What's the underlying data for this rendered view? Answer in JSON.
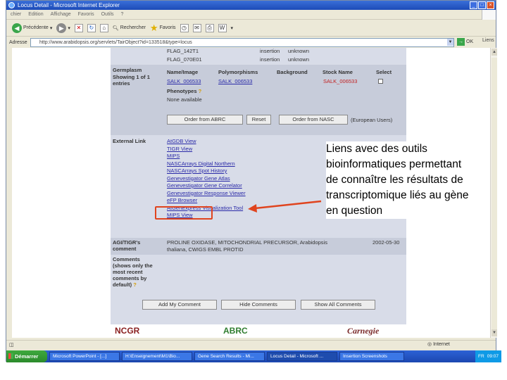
{
  "window": {
    "title": "Locus Detail - Microsoft Internet Explorer",
    "buttons": [
      "_",
      "□",
      "×"
    ]
  },
  "menubar": [
    "chier",
    "Edition",
    "Affichage",
    "Favoris",
    "Outils",
    "?"
  ],
  "toolbar": {
    "back_label": "Précédente",
    "search_label": "Rechercher",
    "favorites_label": "Favoris"
  },
  "address": {
    "label": "Adresse",
    "url": "http://www.arabidopsis.org/servlets/TairObject?id=133518&type=locus",
    "go_label": "OK",
    "links_label": "Liens"
  },
  "page": {
    "top_rows": [
      {
        "name": "FLAG_142T1",
        "type": "insertion",
        "status": "unknown"
      },
      {
        "name": "FLAG_070E01",
        "type": "insertion",
        "status": "unknown"
      }
    ],
    "germplasm": {
      "label": "Germplasm",
      "showing": "Showing 1 of 1 entries",
      "headers": [
        "Name/Image",
        "Polymorphisms",
        "Background",
        "Stock Name",
        "Select"
      ],
      "name_image": "SALK_006533",
      "polymorphism": "SALK_006533",
      "stock_name": "SALK_006533",
      "phenotypes_label": "Phenotypes",
      "phenotypes_value": "None available",
      "buttons": [
        "Order from ABRC",
        "Reset",
        "Order from NASC"
      ],
      "european_users": "(European Users)"
    },
    "external_links": {
      "label": "External Link",
      "links": [
        "AtGDB View",
        "TIGR View",
        "MIPS",
        "NASCArrays Digital Northern",
        "NASCArrays Spot History",
        "Genevestigator Gene Atlas",
        "Genevestigator Gene Correlator",
        "Genevestigator Response Viewer",
        "eFP Browser",
        "AtGenExpress Visualization Tool",
        "MIPS View"
      ],
      "highlighted_index": 8
    },
    "comment": {
      "label": "AGI/TIGR's comment",
      "text_line1": "PROLINE OXIDASE, MITOCHONDRIAL PRECURSOR, Arabidopsis",
      "text_line2": "thaliana, CWIGS EMBL PROTID",
      "date": "2002-05-30"
    },
    "comments": {
      "label": "Comments (shows only the most recent comments by default)",
      "buttons": [
        "Add My Comment",
        "Hide Comments",
        "Show All Comments"
      ]
    },
    "logos": [
      "NCGR",
      "ABRC",
      "Carnegie"
    ]
  },
  "statusbar": {
    "zone": "Internet"
  },
  "taskbar": {
    "start": "Démarrer",
    "tasks": [
      "Microsoft PowerPoint - [...]",
      "H:\\Enseignement\\M1\\Bio...",
      "Gene Search Results - Mi...",
      "Locus Detail - Microsoft ...",
      "Insertion Screenshots"
    ],
    "tray_lang": "FR",
    "clock": "09:07"
  },
  "annotation": {
    "text": "Liens avec des outils bioinformatiques permettant de connaître les résultats de transcriptomique liés au gène en question",
    "arrow_color": "#e0441e",
    "highlight_color": "#e0441e"
  }
}
